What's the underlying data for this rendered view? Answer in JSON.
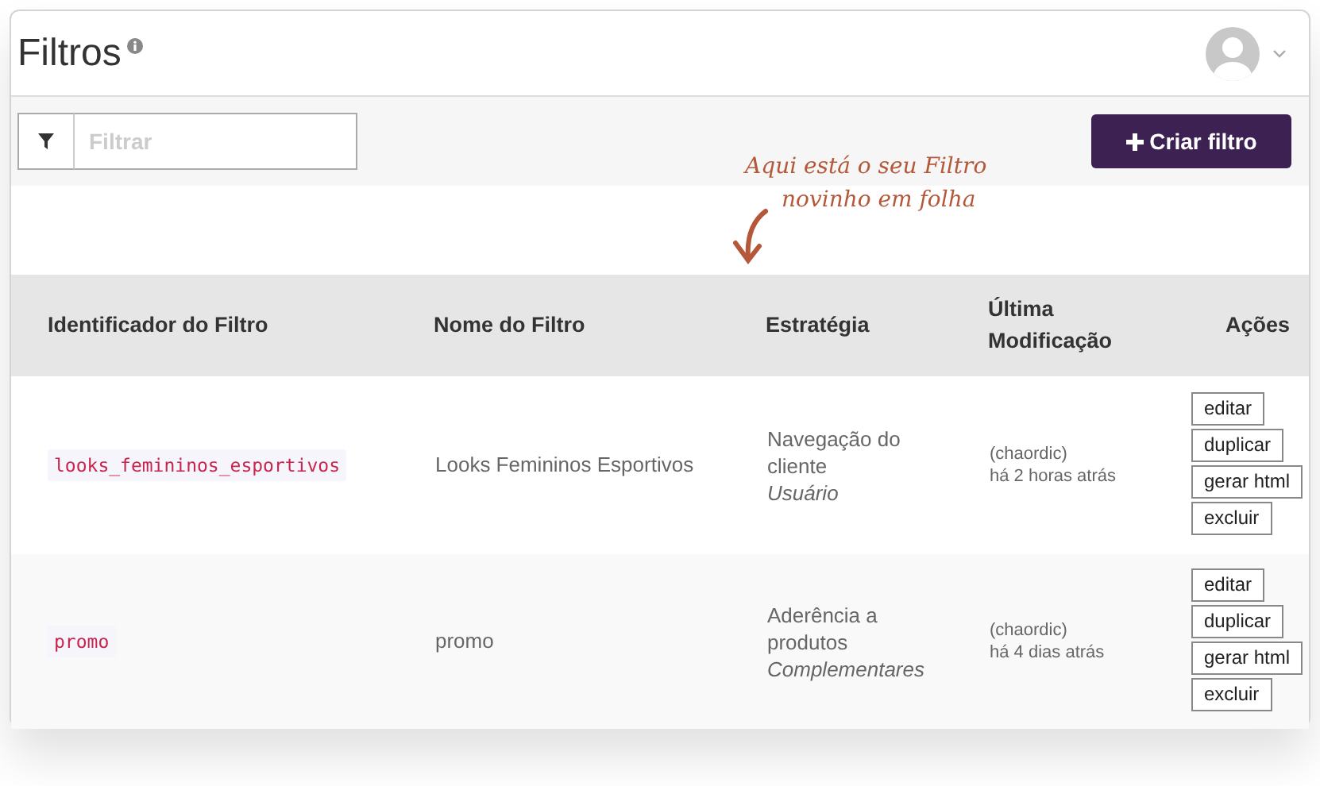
{
  "page": {
    "title": "Filtros"
  },
  "toolbar": {
    "search": {
      "placeholder": "Filtrar"
    },
    "create_button": {
      "label": "Criar filtro"
    }
  },
  "annotation": {
    "lines": [
      "Aqui está o seu Filtro",
      "novinho em folha"
    ]
  },
  "table": {
    "columns": [
      "Identificador do Filtro",
      "Nome do Filtro",
      "Estratégia",
      "Última Modificação",
      "Ações"
    ],
    "rows": [
      {
        "identifier": "looks_femininos_esportivos",
        "name": "Looks Femininos Esportivos",
        "strategy": "Navegação do cliente",
        "strategy_type": "Usuário",
        "author": "(chaordic)",
        "modified": "há 2 horas atrás",
        "actions": [
          "editar",
          "duplicar",
          "gerar html",
          "excluir"
        ]
      },
      {
        "identifier": "promo",
        "name": "promo",
        "strategy": "Aderência a produtos",
        "strategy_type": "Complementares",
        "author": "(chaordic)",
        "modified": "há 4 dias atrás",
        "actions": [
          "editar",
          "duplicar",
          "gerar html",
          "excluir"
        ]
      }
    ]
  }
}
